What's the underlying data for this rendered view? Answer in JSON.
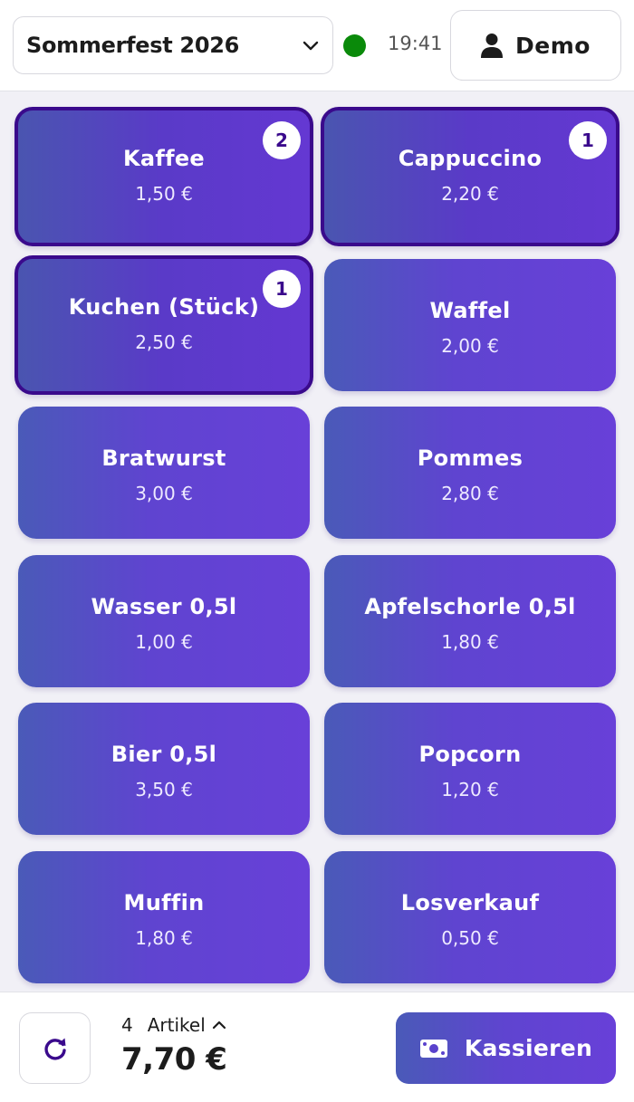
{
  "header": {
    "event_name": "Sommerfest 2026",
    "status_color": "#0a8a0a",
    "time": "19:41",
    "user_name": "Demo",
    "user_icon": "user-icon",
    "select_icon": "chevron-down-icon"
  },
  "products": [
    {
      "name": "Kaffee",
      "price": "1,50 €",
      "qty": "2",
      "selected": true
    },
    {
      "name": "Cappuccino",
      "price": "2,20 €",
      "qty": "1",
      "selected": true
    },
    {
      "name": "Kuchen (Stück)",
      "price": "2,50 €",
      "qty": "1",
      "selected": true
    },
    {
      "name": "Waffel",
      "price": "2,00 €",
      "qty": "",
      "selected": false
    },
    {
      "name": "Bratwurst",
      "price": "3,00 €",
      "qty": "",
      "selected": false
    },
    {
      "name": "Pommes",
      "price": "2,80 €",
      "qty": "",
      "selected": false
    },
    {
      "name": "Wasser 0,5l",
      "price": "1,00 €",
      "qty": "",
      "selected": false
    },
    {
      "name": "Apfelschorle 0,5l",
      "price": "1,80 €",
      "qty": "",
      "selected": false
    },
    {
      "name": "Bier 0,5l",
      "price": "3,50 €",
      "qty": "",
      "selected": false
    },
    {
      "name": "Popcorn",
      "price": "1,20 €",
      "qty": "",
      "selected": false
    },
    {
      "name": "Muffin",
      "price": "1,80 €",
      "qty": "",
      "selected": false
    },
    {
      "name": "Losverkauf",
      "price": "0,50 €",
      "qty": "",
      "selected": false
    }
  ],
  "footer": {
    "refresh_icon": "refresh-icon",
    "cart_count": "4",
    "cart_label": "Artikel",
    "cart_total": "7,70 €",
    "checkout_label": "Kassieren",
    "checkout_icon": "cash-icon"
  },
  "colors": {
    "accent": "#5f44d0",
    "selected_border": "#3a0a8c"
  }
}
